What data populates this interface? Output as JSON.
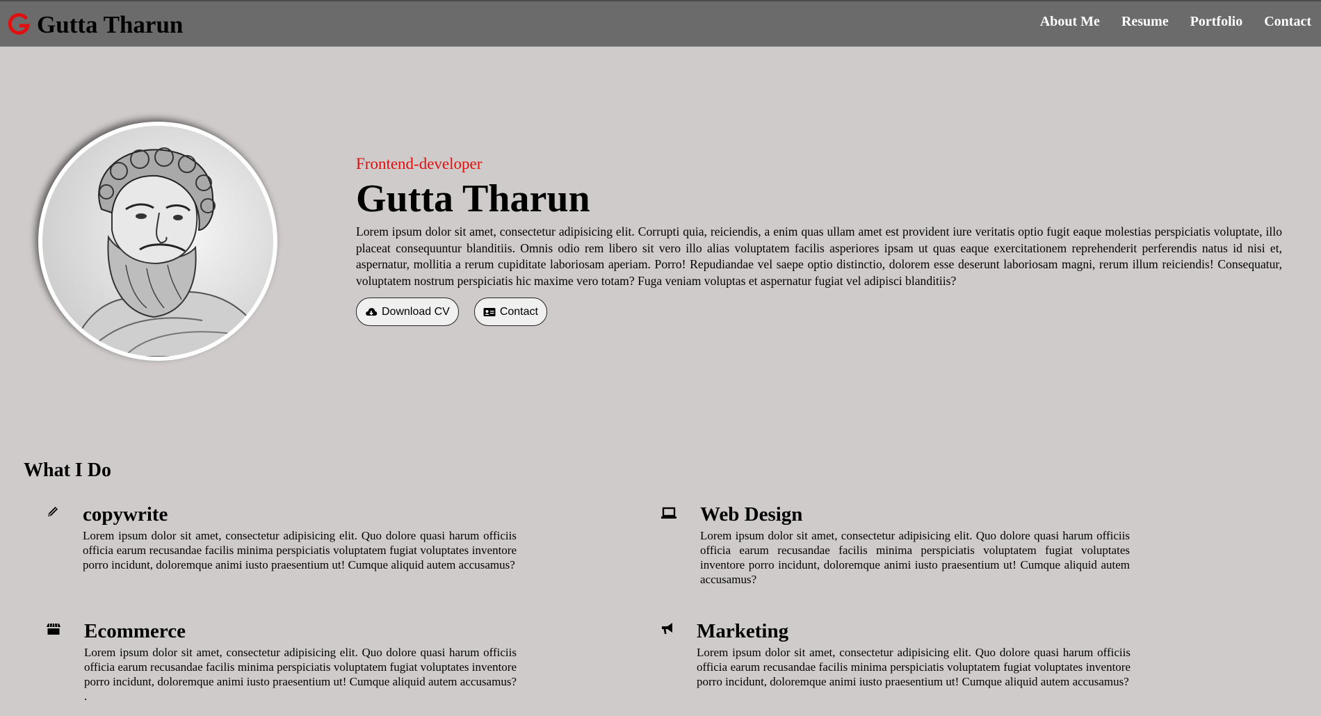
{
  "header": {
    "brand_name": "Gutta Tharun",
    "brand_logo_letter": "G",
    "nav": [
      {
        "label": "About Me"
      },
      {
        "label": "Resume"
      },
      {
        "label": "Portfolio"
      },
      {
        "label": "Contact"
      }
    ]
  },
  "hero": {
    "role": "Frontend-developer",
    "name": "Gutta Tharun",
    "description": "Lorem ipsum dolor sit amet, consectetur adipisicing elit. Corrupti quia, reiciendis, a enim quas ullam amet est provident iure veritatis optio fugit eaque molestias perspiciatis voluptate, illo placeat consequuntur blanditiis. Omnis odio rem libero sit vero illo alias voluptatem facilis asperiores ipsam ut quas eaque exercitationem reprehenderit perferendis natus id nisi et, aspernatur, mollitia a rerum cupiditate laboriosam aperiam. Porro! Repudiandae vel saepe optio distinctio, dolorem esse deserunt laboriosam magni, rerum illum reiciendis! Consequatur, voluptatem nostrum perspiciatis hic maxime vero totam? Fuga veniam voluptas et aspernatur fugiat vel adipisci blanditiis?",
    "buttons": {
      "download_cv": "Download CV",
      "contact": "Contact"
    }
  },
  "what_i_do": {
    "title": "What I Do",
    "services": [
      {
        "icon": "pencil-icon",
        "title": "copywrite",
        "text": "Lorem ipsum dolor sit amet, consectetur adipisicing elit. Quo dolore quasi harum officiis officia earum recusandae facilis minima perspiciatis voluptatem fugiat voluptates inventore porro incidunt, doloremque animi iusto praesentium ut! Cumque aliquid autem accusamus?"
      },
      {
        "icon": "laptop-icon",
        "title": "Web Design",
        "text": "Lorem ipsum dolor sit amet, consectetur adipisicing elit. Quo dolore quasi harum officiis officia earum recusandae facilis minima perspiciatis voluptatem fugiat voluptates inventore porro incidunt, doloremque animi iusto praesentium ut! Cumque aliquid autem accusamus?"
      },
      {
        "icon": "store-icon",
        "title": "Ecommerce",
        "text": "Lorem ipsum dolor sit amet, consectetur adipisicing elit. Quo dolore quasi harum officiis officia earum recusandae facilis minima perspiciatis voluptatem fugiat voluptates inventore porro incidunt, doloremque animi iusto praesentium ut! Cumque aliquid autem accusamus? ."
      },
      {
        "icon": "megaphone-icon",
        "title": "Marketing",
        "text": "Lorem ipsum dolor sit amet, consectetur adipisicing elit. Quo dolore quasi harum officiis officia earum recusandae facilis minima perspiciatis voluptatem fugiat voluptates inventore porro incidunt, doloremque animi iusto praesentium ut! Cumque aliquid autem accusamus?"
      }
    ]
  },
  "colors": {
    "header_bg": "#6b6b6b",
    "page_bg": "#d0cbcb",
    "accent_red": "#e01010",
    "nav_text": "#ffffff"
  }
}
